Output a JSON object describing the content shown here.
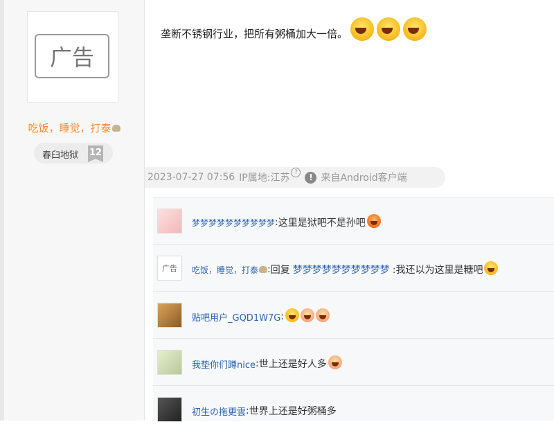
{
  "author": {
    "avatar_text": "广告",
    "username": "吃饭，睡觉，打泰",
    "badge_label": "春臼地狱",
    "badge_level": "12"
  },
  "post": {
    "text": "垄断不锈钢行业，把所有粥桶加大一倍。",
    "timestamp": "2023-07-27 07:56",
    "ip_location": "IP属地:江苏",
    "source": "来自Android客户端"
  },
  "comments": [
    {
      "user": "梦梦梦梦梦梦梦梦梦梦",
      "separator": ":",
      "text": " 这里是狱吧不是孙吧"
    },
    {
      "user": "吃饭，睡觉，打泰",
      "separator": ":",
      "reply_prefix": " 回复 ",
      "reply_target": "梦梦梦梦梦梦梦梦梦梦",
      "text": " :我还以为这里是糖吧",
      "avatar_text": "广告"
    },
    {
      "user": "贴吧用户_GQD1W7G",
      "separator": ":",
      "text": ""
    },
    {
      "user": "我垫你们蹲nice",
      "separator": ":",
      "text": " 世上还是好人多"
    },
    {
      "user": "初生の拖更雲",
      "separator": ":",
      "text": " 世界上还是好粥桶多"
    }
  ],
  "colors": {
    "username_orange": "#ff8a2a",
    "link_blue": "#2d64b3"
  }
}
